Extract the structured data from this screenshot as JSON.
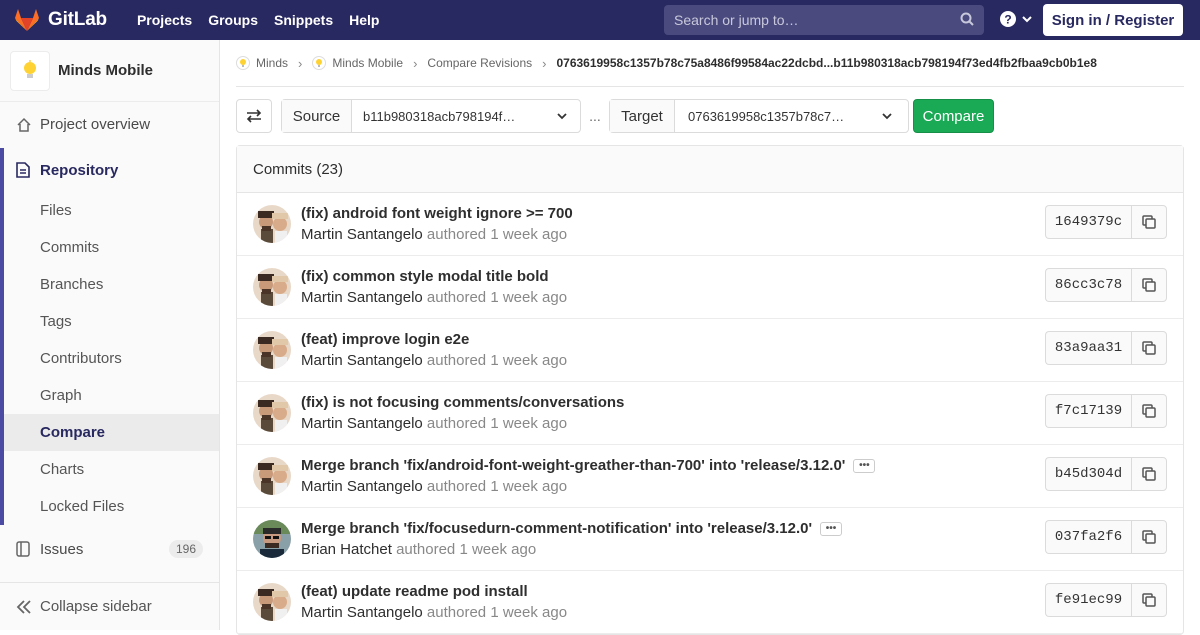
{
  "topbar": {
    "brand": "GitLab",
    "nav": [
      "Projects",
      "Groups",
      "Snippets",
      "Help"
    ],
    "search_placeholder": "Search or jump to…",
    "signin": "Sign in / Register"
  },
  "sidebar": {
    "project_name": "Minds Mobile",
    "overview": "Project overview",
    "repository": "Repository",
    "items": [
      "Files",
      "Commits",
      "Branches",
      "Tags",
      "Contributors",
      "Graph",
      "Compare",
      "Charts",
      "Locked Files"
    ],
    "active_item": "Compare",
    "issues": "Issues",
    "issues_count": "196",
    "collapse": "Collapse sidebar"
  },
  "breadcrumb": [
    "Minds",
    "Minds Mobile",
    "Compare Revisions",
    "0763619958c1357b78c75a8486f99584ac22dcbd...b11b980318acb798194f73ed4fb2fbaa9cb0b1e8"
  ],
  "compare": {
    "source_label": "Source",
    "source_value": "b11b980318acb798194f…",
    "dots": "...",
    "target_label": "Target",
    "target_value": "0763619958c1357b78c7…",
    "button": "Compare"
  },
  "commits_header": "Commits (23)",
  "commits": [
    {
      "title": "(fix) android font weight ignore >= 700",
      "author": "Martin Santangelo",
      "verb": "authored",
      "time": "1 week ago",
      "sha": "1649379c",
      "ellipsis": false,
      "avatar": "martin"
    },
    {
      "title": "(fix) common style modal title bold",
      "author": "Martin Santangelo",
      "verb": "authored",
      "time": "1 week ago",
      "sha": "86cc3c78",
      "ellipsis": false,
      "avatar": "martin"
    },
    {
      "title": "(feat) improve login e2e",
      "author": "Martin Santangelo",
      "verb": "authored",
      "time": "1 week ago",
      "sha": "83a9aa31",
      "ellipsis": false,
      "avatar": "martin"
    },
    {
      "title": "(fix) is not focusing comments/conversations",
      "author": "Martin Santangelo",
      "verb": "authored",
      "time": "1 week ago",
      "sha": "f7c17139",
      "ellipsis": false,
      "avatar": "martin"
    },
    {
      "title": "Merge branch 'fix/android-font-weight-greather-than-700' into 'release/3.12.0'",
      "author": "Martin Santangelo",
      "verb": "authored",
      "time": "1 week ago",
      "sha": "b45d304d",
      "ellipsis": true,
      "avatar": "martin"
    },
    {
      "title": "Merge branch 'fix/focusedurn-comment-notification' into 'release/3.12.0'",
      "author": "Brian Hatchet",
      "verb": "authored",
      "time": "1 week ago",
      "sha": "037fa2f6",
      "ellipsis": true,
      "avatar": "brian"
    },
    {
      "title": "(feat) update readme pod install",
      "author": "Martin Santangelo",
      "verb": "authored",
      "time": "1 week ago",
      "sha": "fe91ec99",
      "ellipsis": false,
      "avatar": "martin"
    }
  ],
  "colors": {
    "topbar": "#292961",
    "accent": "#4b4ba3",
    "compare_button": "#1aaa55"
  }
}
